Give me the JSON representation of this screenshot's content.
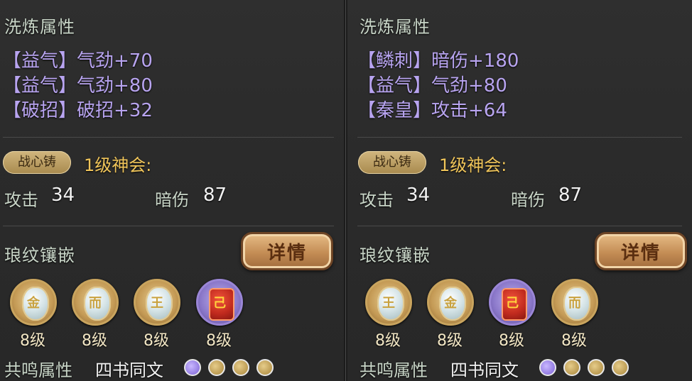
{
  "left": {
    "wash_title": "洗炼属性",
    "wash_attrs": [
      "【益气】气劲+70",
      "【益气】气劲+80",
      "【破招】破招+32"
    ],
    "badge": "战心铸",
    "shenhui": "1级神会:",
    "stats": [
      {
        "label": "攻击",
        "value": "34"
      },
      {
        "label": "暗伤",
        "value": "87"
      }
    ],
    "inlay_title": "琅纹镶嵌",
    "detail_btn": "详情",
    "gems": [
      {
        "level": "8级",
        "frame": "gold",
        "glyph": "金",
        "core": "white"
      },
      {
        "level": "8级",
        "frame": "gold",
        "glyph": "而",
        "core": "white"
      },
      {
        "level": "8级",
        "frame": "gold",
        "glyph": "王",
        "core": "white"
      },
      {
        "level": "8级",
        "frame": "purple",
        "glyph": "己",
        "core": "red"
      }
    ],
    "resonance_label": "共鸣属性",
    "resonance_name": "四书同文",
    "resonance_dots": [
      "purple",
      "gold",
      "gold",
      "gold"
    ]
  },
  "right": {
    "wash_title": "洗炼属性",
    "wash_attrs": [
      "【鳞刺】暗伤+180",
      "【益气】气劲+80",
      "【秦皇】攻击+64"
    ],
    "badge": "战心铸",
    "shenhui": "1级神会:",
    "stats": [
      {
        "label": "攻击",
        "value": "34"
      },
      {
        "label": "暗伤",
        "value": "87"
      }
    ],
    "inlay_title": "琅纹镶嵌",
    "detail_btn": "详情",
    "gems": [
      {
        "level": "8级",
        "frame": "gold",
        "glyph": "王",
        "core": "white"
      },
      {
        "level": "8级",
        "frame": "gold",
        "glyph": "金",
        "core": "white"
      },
      {
        "level": "8级",
        "frame": "purple",
        "glyph": "己",
        "core": "red"
      },
      {
        "level": "8级",
        "frame": "gold",
        "glyph": "而",
        "core": "white"
      }
    ],
    "resonance_label": "共鸣属性",
    "resonance_name": "四书同文",
    "resonance_dots": [
      "purple",
      "gold",
      "gold",
      "gold"
    ]
  }
}
